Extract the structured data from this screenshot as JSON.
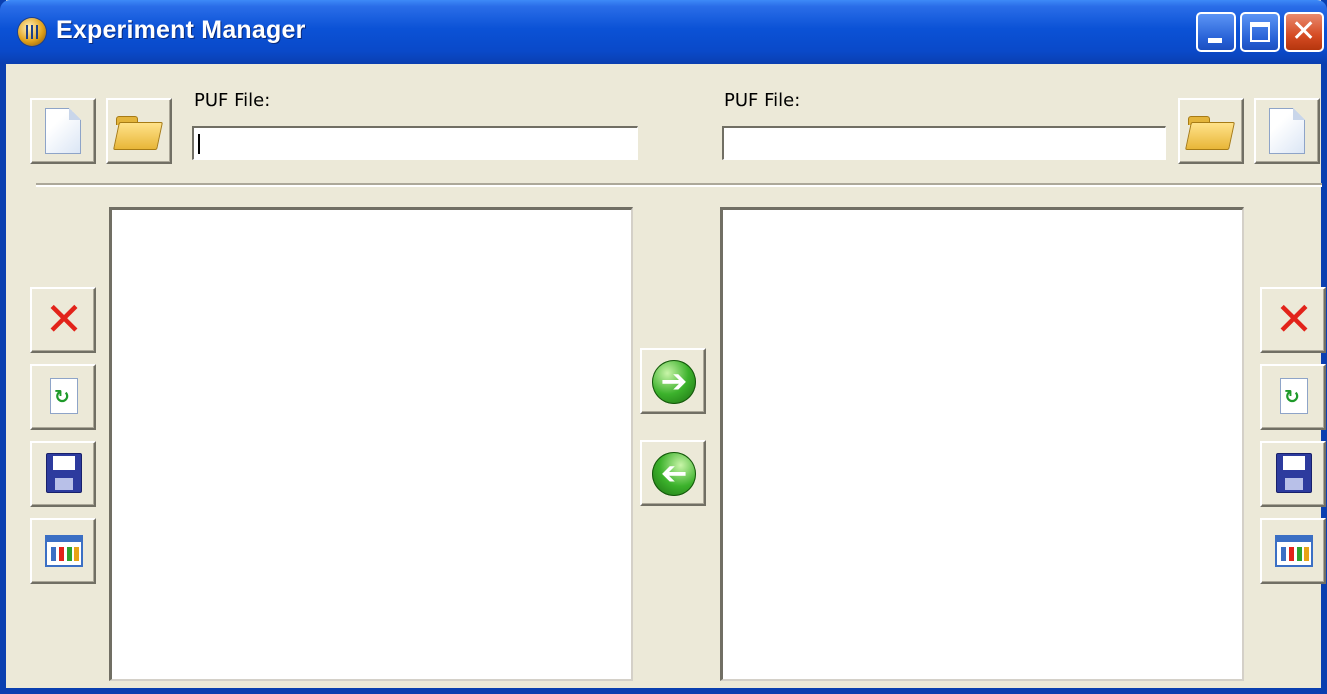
{
  "window": {
    "title": "Experiment Manager"
  },
  "left_panel": {
    "file_label": "PUF File:",
    "file_value": ""
  },
  "right_panel": {
    "file_label": "PUF File:",
    "file_value": ""
  },
  "icons": {
    "new": "new-document-icon",
    "open": "open-folder-icon",
    "delete": "delete-x-icon",
    "refresh": "refresh-document-icon",
    "save": "save-floppy-icon",
    "properties": "properties-grid-icon",
    "transfer_right": "arrow-right-icon",
    "transfer_left": "arrow-left-icon"
  },
  "colors": {
    "titlebar": "#0b52d6",
    "window_bg": "#ece9d8",
    "close_button": "#d54b23",
    "delete_icon": "#e2231a",
    "arrow_green": "#3cb22c"
  }
}
